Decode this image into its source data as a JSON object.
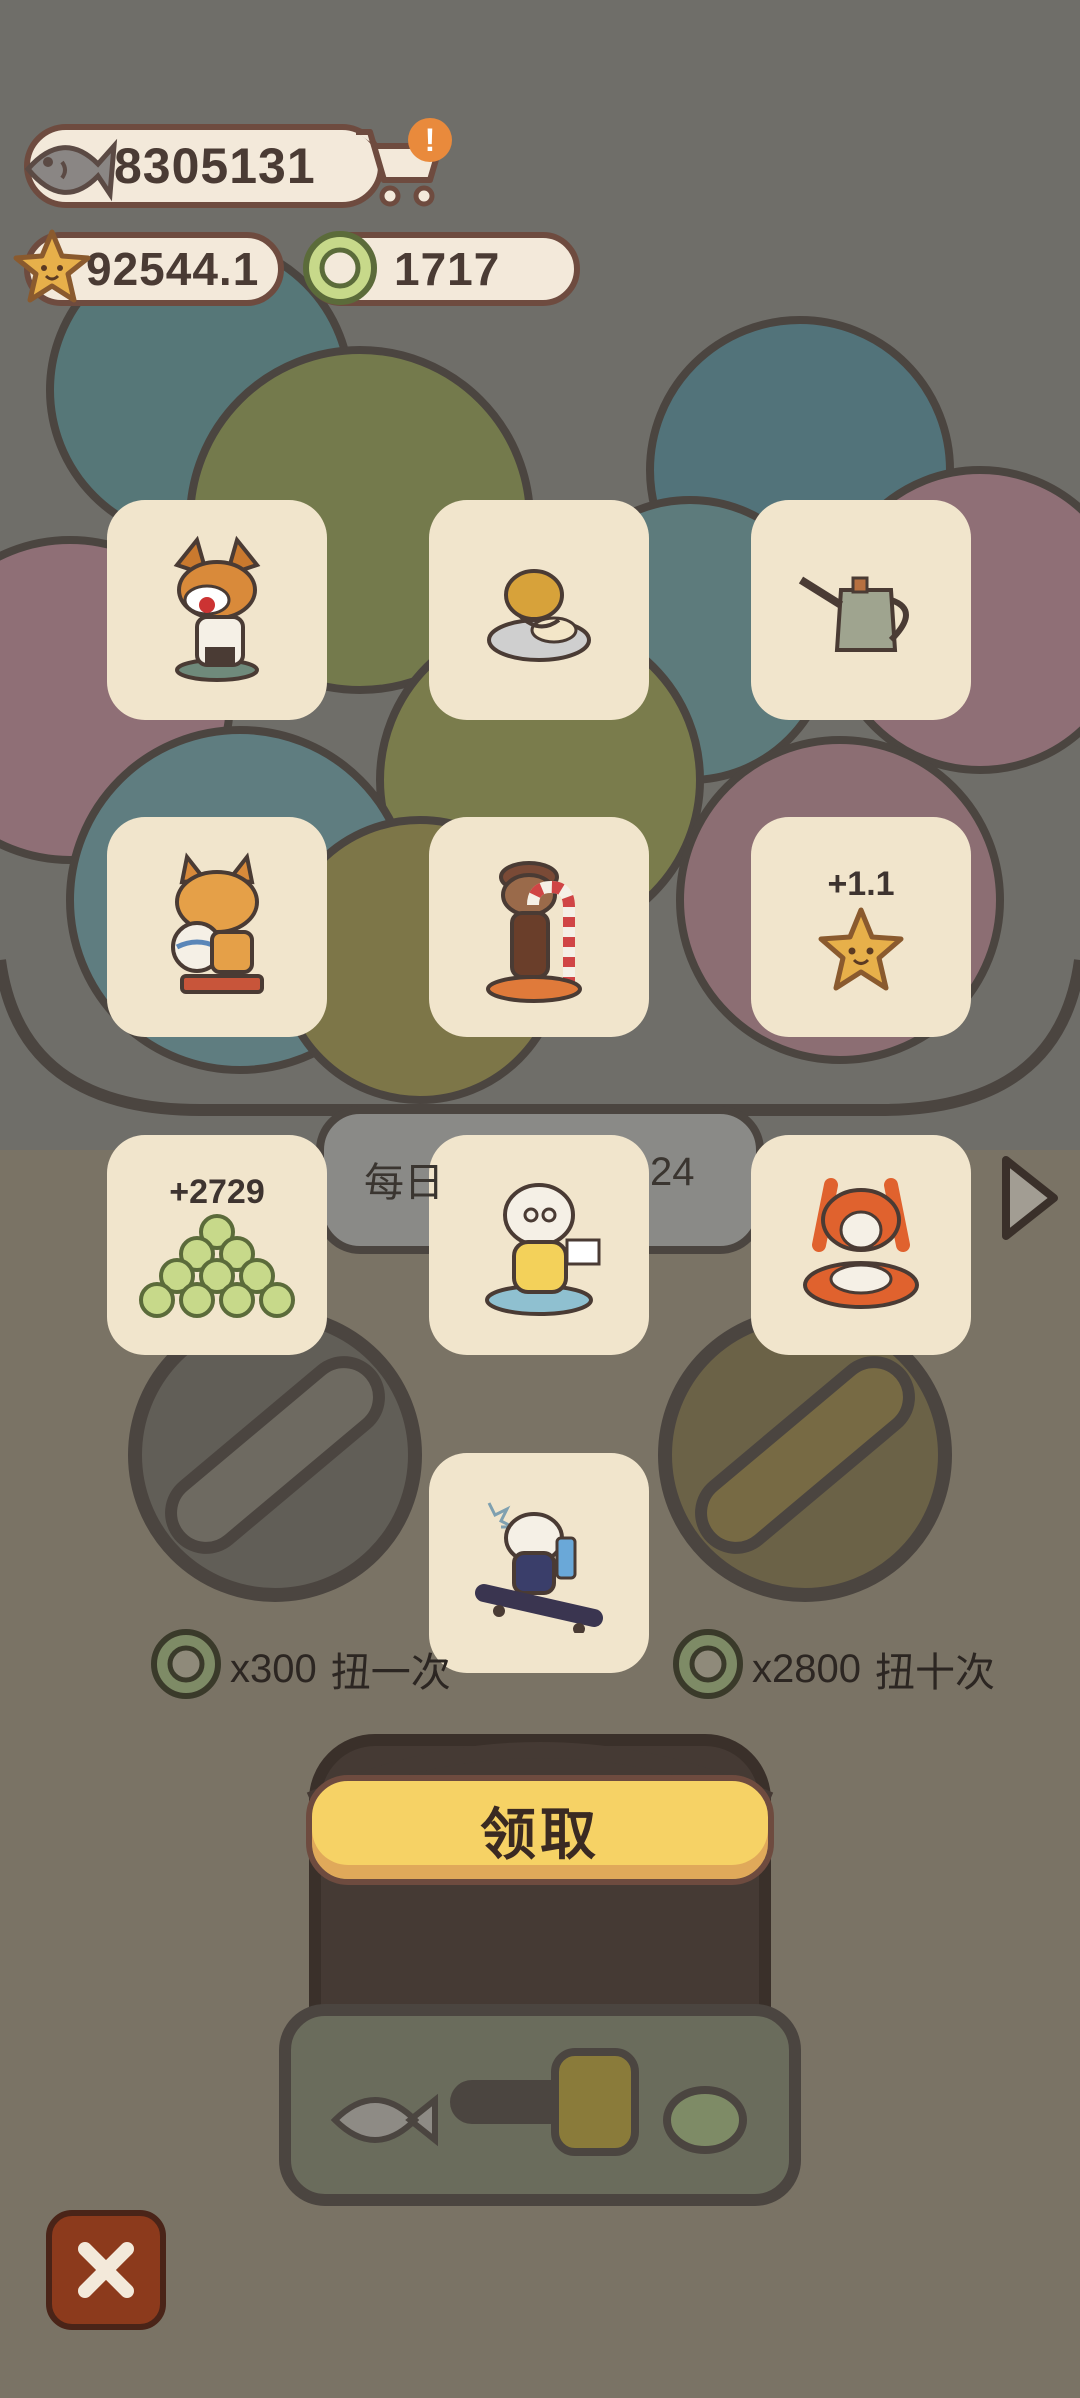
{
  "hud": {
    "fish_count": "8305131",
    "star_count": "92544.1",
    "coin_count": "1717",
    "cart_badge": "!"
  },
  "rewards": [
    {
      "name": "corgi-chef-figurine",
      "amount": ""
    },
    {
      "name": "cat-curry-plate-figurine",
      "amount": ""
    },
    {
      "name": "watering-can-item",
      "amount": ""
    },
    {
      "name": "lynx-volleyball-figurine",
      "amount": ""
    },
    {
      "name": "candy-cane-pup-figurine",
      "amount": ""
    },
    {
      "name": "star-reward",
      "amount": "+1.1"
    },
    {
      "name": "coin-pile-reward",
      "amount": "+2729"
    },
    {
      "name": "bear-chef-figurine",
      "amount": ""
    },
    {
      "name": "carrot-bunny-cat-figurine",
      "amount": ""
    },
    {
      "name": "skateboard-raccoon-figurine",
      "amount": ""
    }
  ],
  "daily_label_left": "每日",
  "daily_label_right": "24",
  "single_spin": {
    "cost": "x300",
    "label": "扭一次"
  },
  "ten_spin": {
    "cost": "x2800",
    "label": "扭十次"
  },
  "claim_button": "领取",
  "colors": {
    "card_bg": "#f1e5cc",
    "claim_yellow": "#f6d265",
    "close_red": "#8c3a1c",
    "outline_brown": "#6e4b3f"
  }
}
